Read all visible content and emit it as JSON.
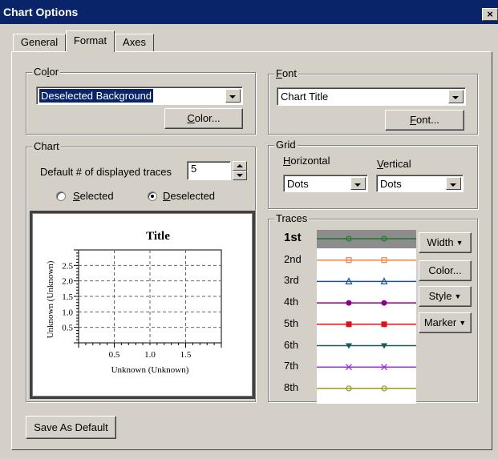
{
  "window": {
    "title": "Chart Options",
    "close_glyph": "×"
  },
  "tabs": [
    {
      "label": "General",
      "active": false
    },
    {
      "label": "Format",
      "active": true
    },
    {
      "label": "Axes",
      "active": false
    }
  ],
  "color_group": {
    "legend": "Color",
    "legend_mnemonic_pre": "Co",
    "legend_mnemonic_u": "l",
    "legend_mnemonic_post": "or",
    "dropdown_value": "Deselected Background",
    "button_u": "C",
    "button_rest": "olor..."
  },
  "font_group": {
    "legend_u": "F",
    "legend_rest": "ont",
    "dropdown_value": "Chart Title",
    "button_u": "F",
    "button_rest": "ont..."
  },
  "chart_group": {
    "legend": "Chart",
    "traces_label": "Default # of displayed traces",
    "traces_value": "5",
    "radio_selected_u": "S",
    "radio_selected_rest": "elected",
    "radio_deselected_u": "D",
    "radio_deselected_rest": "eselected",
    "selected_option": "deselected",
    "preview_title": "Title",
    "preview_xlabel": "Unknown (Unknown)",
    "preview_ylabel": "Unknown (Unknown)"
  },
  "grid_group": {
    "legend": "Grid",
    "horizontal_u": "H",
    "horizontal_rest": "orizontal",
    "vertical_u": "V",
    "vertical_rest": "ertical",
    "horizontal_value": "Dots",
    "vertical_value": "Dots"
  },
  "traces_group": {
    "legend": "Traces",
    "traces": [
      {
        "label": "1st",
        "color": "#1a7a2a",
        "marker": "circle-open",
        "selected": true
      },
      {
        "label": "2nd",
        "color": "#f08040",
        "marker": "square-open",
        "selected": false
      },
      {
        "label": "3rd",
        "color": "#1a4f9a",
        "marker": "triangle-open",
        "selected": false
      },
      {
        "label": "4th",
        "color": "#8a008a",
        "marker": "circle-filled",
        "selected": false
      },
      {
        "label": "5th",
        "color": "#e0101a",
        "marker": "square-filled",
        "selected": false
      },
      {
        "label": "6th",
        "color": "#1a5a5a",
        "marker": "triangle-down-filled",
        "selected": false
      },
      {
        "label": "7th",
        "color": "#9a30e0",
        "marker": "x",
        "selected": false
      },
      {
        "label": "8th",
        "color": "#9a9a20",
        "marker": "circle-open",
        "selected": false
      }
    ],
    "width_label": "Width",
    "color_label": "Color...",
    "style_label": "Style",
    "marker_label": "Marker",
    "caret_glyph": "▼"
  },
  "save_default_label": "Save As Default",
  "chart_data": {
    "type": "line",
    "title": "Title",
    "xlabel": "Unknown (Unknown)",
    "ylabel": "Unknown (Unknown)",
    "x_ticks": [
      "0.5",
      "1.0",
      "1.5"
    ],
    "y_ticks": [
      "0.5",
      "1.0",
      "1.5",
      "2.0",
      "2.5"
    ],
    "xlim": [
      0,
      2
    ],
    "ylim": [
      0,
      3
    ],
    "grid": true,
    "series": []
  }
}
